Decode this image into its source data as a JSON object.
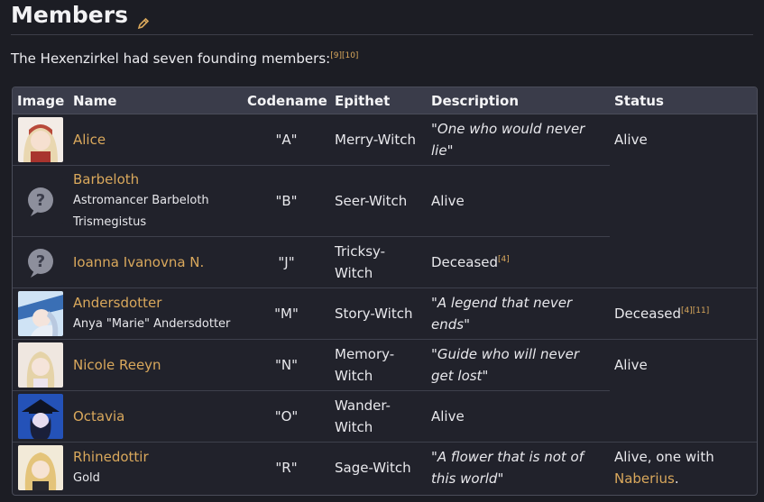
{
  "section": {
    "title": "Members",
    "edit_icon": "pencil-icon"
  },
  "intro": {
    "text": "The Hexenzirkel had seven founding members:",
    "cites": "[9][10]"
  },
  "table": {
    "headers": [
      "Image",
      "Name",
      "Codename",
      "Epithet",
      "Description",
      "Status"
    ],
    "rows": [
      {
        "name": "Alice",
        "subname": "",
        "codename": "\"A\"",
        "epithet": "Merry-Witch",
        "description": "\"One who would never lie\"",
        "status": "Alive",
        "status_cite": "",
        "status_link": "",
        "status_end": "",
        "avatar": "alice-portrait"
      },
      {
        "name": "Barbeloth",
        "subname": "Astromancer Barbeloth Trismegistus",
        "codename": "\"B\"",
        "epithet": "Seer-Witch",
        "description": "",
        "status": "Alive",
        "status_cite": "",
        "status_link": "",
        "status_end": "",
        "avatar": "unknown-icon"
      },
      {
        "name": "Ioanna Ivanovna N.",
        "subname": "",
        "codename": "\"J\"",
        "epithet": "Tricksy-Witch",
        "description": "",
        "status": "Deceased",
        "status_cite": "[4]",
        "status_link": "",
        "status_end": "",
        "avatar": "unknown-icon"
      },
      {
        "name": "Andersdotter",
        "subname": "Anya \"Marie\" Andersdotter",
        "codename": "\"M\"",
        "epithet": "Story-Witch",
        "description": "\"A legend that never ends\"",
        "status": "Deceased",
        "status_cite": "[4][11]",
        "status_link": "",
        "status_end": "",
        "avatar": "andersdotter-portrait"
      },
      {
        "name": "Nicole Reeyn",
        "subname": "",
        "codename": "\"N\"",
        "epithet": "Memory-Witch",
        "description": "\"Guide who will never get lost\"",
        "status": "Alive",
        "status_cite": "",
        "status_link": "",
        "status_end": "",
        "avatar": "nicole-portrait"
      },
      {
        "name": "Octavia",
        "subname": "",
        "codename": "\"O\"",
        "epithet": "Wander-Witch",
        "description": "",
        "status": "Alive",
        "status_cite": "",
        "status_link": "",
        "status_end": "",
        "avatar": "octavia-portrait"
      },
      {
        "name": "Rhinedottir",
        "subname": "Gold",
        "codename": "\"R\"",
        "epithet": "Sage-Witch",
        "description": "\"A flower that is not of this world\"",
        "status": "Alive, one with ",
        "status_cite": "",
        "status_link": "Naberius",
        "status_end": ".",
        "avatar": "rhinedottir-portrait"
      }
    ]
  },
  "colors": {
    "link": "#d9a85c",
    "header_bg": "#3a3c4a",
    "page_bg": "#1c1d24"
  }
}
